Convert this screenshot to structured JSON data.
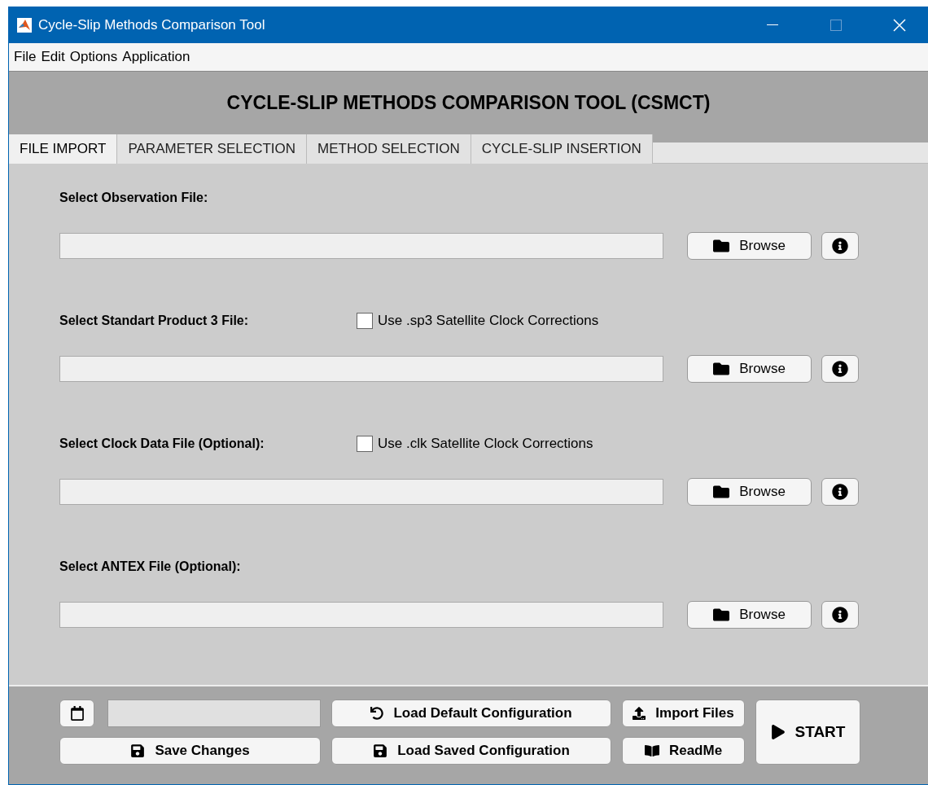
{
  "window": {
    "title": "Cycle-Slip Methods Comparison Tool"
  },
  "menu": [
    "File",
    "Edit",
    "Options",
    "Application"
  ],
  "header": "CYCLE-SLIP METHODS COMPARISON TOOL (CSMCT)",
  "tabs": [
    {
      "label": "FILE IMPORT",
      "selected": true
    },
    {
      "label": "PARAMETER SELECTION",
      "selected": false
    },
    {
      "label": "METHOD SELECTION",
      "selected": false
    },
    {
      "label": "CYCLE-SLIP INSERTION",
      "selected": false
    }
  ],
  "files": [
    {
      "label": "Select Observation File:",
      "button": "Browse"
    },
    {
      "label": "Select Standart Product 3 File:",
      "checkbox": {
        "label": "Use .sp3 Satellite Clock Corrections",
        "checked": false
      },
      "button": "Browse"
    },
    {
      "label": "Select Clock Data File (Optional):",
      "checkbox": {
        "label": "Use .clk Satellite Clock Corrections",
        "checked": false
      },
      "button": "Browse"
    },
    {
      "label": "Select ANTEX File (Optional):",
      "button": "Browse"
    }
  ],
  "footer": {
    "load_default": "Load Default Configuration",
    "import": "Import Files",
    "save": "Save Changes",
    "load_saved": "Load Saved Configuration",
    "readme": "ReadMe",
    "start": "START"
  }
}
